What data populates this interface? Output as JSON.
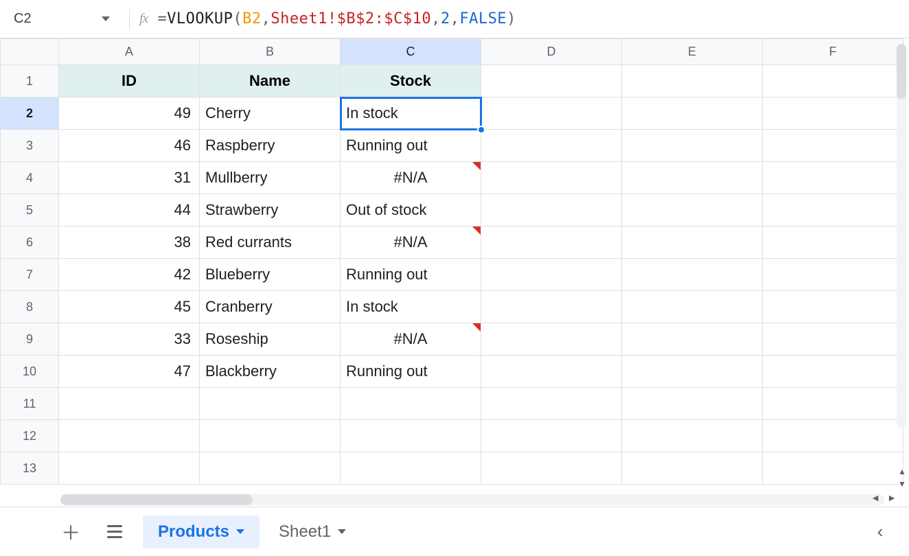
{
  "namebox": {
    "cellRef": "C2"
  },
  "formula": {
    "parts": [
      {
        "t": "=",
        "cls": "tok-pn"
      },
      {
        "t": "VLOOKUP",
        "cls": "tok-fn"
      },
      {
        "t": "(",
        "cls": "tok-pn"
      },
      {
        "t": "B2",
        "cls": "tok-ref1"
      },
      {
        "t": ",",
        "cls": "tok-pn"
      },
      {
        "t": "Sheet1!$B$2:$C$10",
        "cls": "tok-ref2"
      },
      {
        "t": ",",
        "cls": "tok-pn"
      },
      {
        "t": "2",
        "cls": "tok-num"
      },
      {
        "t": ",",
        "cls": "tok-pn"
      },
      {
        "t": "FALSE",
        "cls": "tok-bool"
      },
      {
        "t": ")",
        "cls": "tok-pn"
      }
    ]
  },
  "columns": [
    "A",
    "B",
    "C",
    "D",
    "E",
    "F"
  ],
  "selectedCol": "C",
  "selectedRow": 2,
  "rowCount": 13,
  "header": {
    "A": "ID",
    "B": "Name",
    "C": "Stock"
  },
  "rows": [
    {
      "id": "49",
      "name": "Cherry",
      "stock": "In stock",
      "err": false,
      "center": false
    },
    {
      "id": "46",
      "name": "Raspberry",
      "stock": "Running out",
      "err": false,
      "center": false
    },
    {
      "id": "31",
      "name": "Mullberry",
      "stock": "#N/A",
      "err": true,
      "center": true
    },
    {
      "id": "44",
      "name": "Strawberry",
      "stock": "Out of stock",
      "err": false,
      "center": false
    },
    {
      "id": "38",
      "name": "Red currants",
      "stock": "#N/A",
      "err": true,
      "center": true
    },
    {
      "id": "42",
      "name": "Blueberry",
      "stock": "Running out",
      "err": false,
      "center": false
    },
    {
      "id": "45",
      "name": "Cranberry",
      "stock": "In stock",
      "err": false,
      "center": false
    },
    {
      "id": "33",
      "name": "Roseship",
      "stock": "#N/A",
      "err": true,
      "center": true
    },
    {
      "id": "47",
      "name": "Blackberry",
      "stock": "Running out",
      "err": false,
      "center": false
    }
  ],
  "tabs": [
    {
      "label": "Products",
      "active": true
    },
    {
      "label": "Sheet1",
      "active": false
    }
  ],
  "fxLabel": "fx"
}
